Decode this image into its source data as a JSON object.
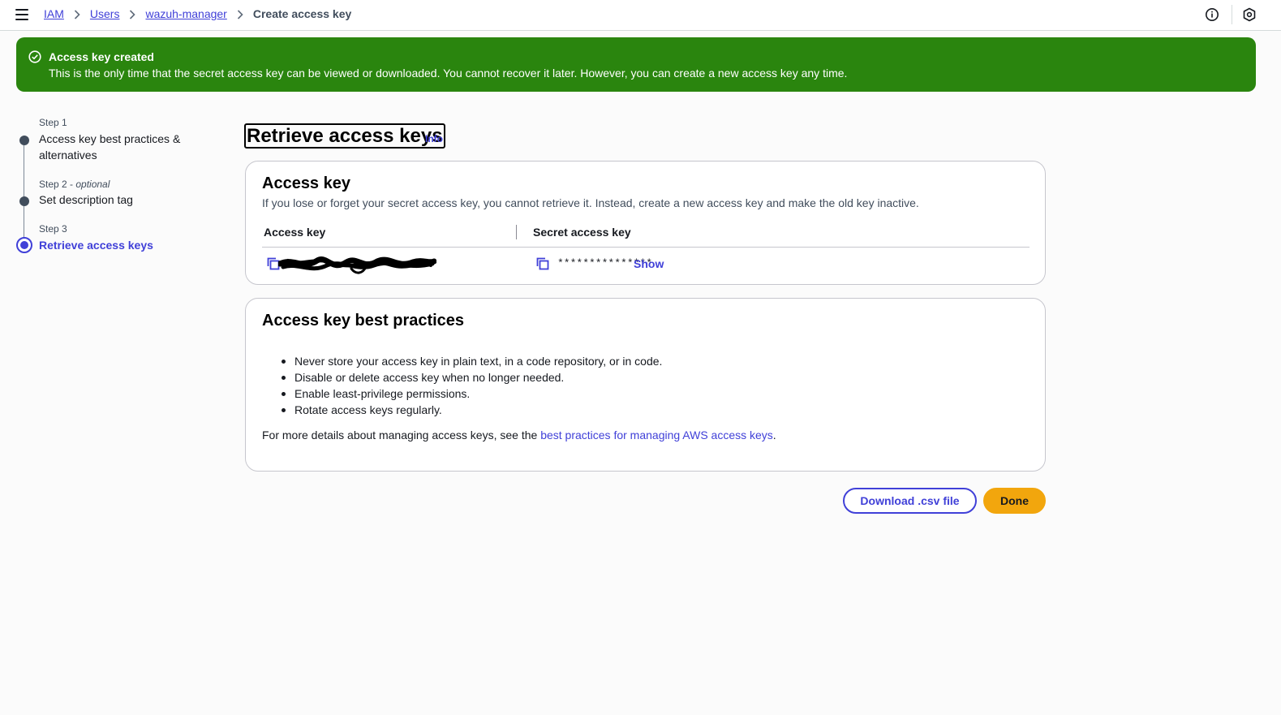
{
  "breadcrumb": {
    "items": [
      "IAM",
      "Users",
      "wazuh-manager"
    ],
    "current": "Create access key"
  },
  "flash": {
    "title": "Access key created",
    "message": "This is the only time that the secret access key can be viewed or downloaded. You cannot recover it later. However, you can create a new access key any time.",
    "color": "#2a850e"
  },
  "steps": [
    {
      "small": "Step 1",
      "optional": "",
      "label": "Access key best practices & alternatives",
      "label_line1": "Access key best practices &",
      "label_line2": "alternatives"
    },
    {
      "small": "Step 2 - ",
      "optional": "optional",
      "label": "Set description tag"
    },
    {
      "small": "Step 3",
      "optional": "",
      "label": "Retrieve access keys",
      "active": true
    }
  ],
  "page": {
    "title": "Retrieve access keys",
    "info": "Info"
  },
  "access_key_panel": {
    "title": "Access key",
    "description": "If you lose or forget your secret access key, you cannot retrieve it. Instead, create a new access key and make the old key inactive.",
    "col_access_key": "Access key",
    "col_secret_key": "Secret access key",
    "secret_masked": "***************",
    "show_label": "Show"
  },
  "best_practices": {
    "title": "Access key best practices",
    "items": [
      "Never store your access key in plain text, in a code repository, or in code.",
      "Disable or delete access key when no longer needed.",
      "Enable least-privilege permissions.",
      "Rotate access keys regularly."
    ],
    "more_prefix": "For more details about managing access keys, see the ",
    "more_link": "best practices for managing AWS access keys",
    "more_suffix": "."
  },
  "buttons": {
    "download": "Download .csv file",
    "done": "Done"
  },
  "colors": {
    "accent": "#4040d8",
    "primary_button": "#f2a60d",
    "success": "#2a850e"
  }
}
